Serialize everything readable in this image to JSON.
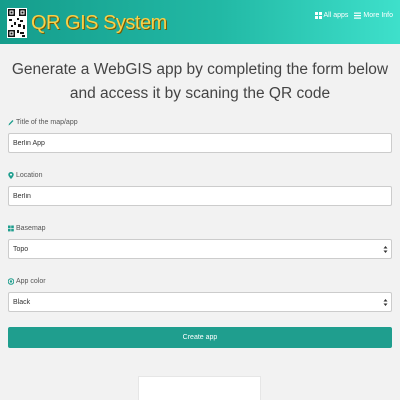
{
  "app": {
    "brand": "QR GIS System",
    "nav": [
      {
        "label": "All apps",
        "icon": "grid-icon"
      },
      {
        "label": "More Info",
        "icon": "list-icon"
      }
    ]
  },
  "headline": "Generate a WebGIS app by completing the form below and access it by scaning the QR code",
  "form": {
    "title": {
      "label": "Title of the map/app",
      "value": "Berlin App",
      "icon": "pencil-icon"
    },
    "location": {
      "label": "Location",
      "value": "Berlin",
      "icon": "map-marker-icon"
    },
    "basemap": {
      "label": "Basemap",
      "value": "Topo",
      "icon": "grid-map-icon"
    },
    "color": {
      "label": "App color",
      "value": "Black",
      "icon": "color-wheel-icon"
    },
    "submit_label": "Create app"
  },
  "colors": {
    "accent": "#1f9e8e",
    "brand_text": "#f7d04a"
  }
}
